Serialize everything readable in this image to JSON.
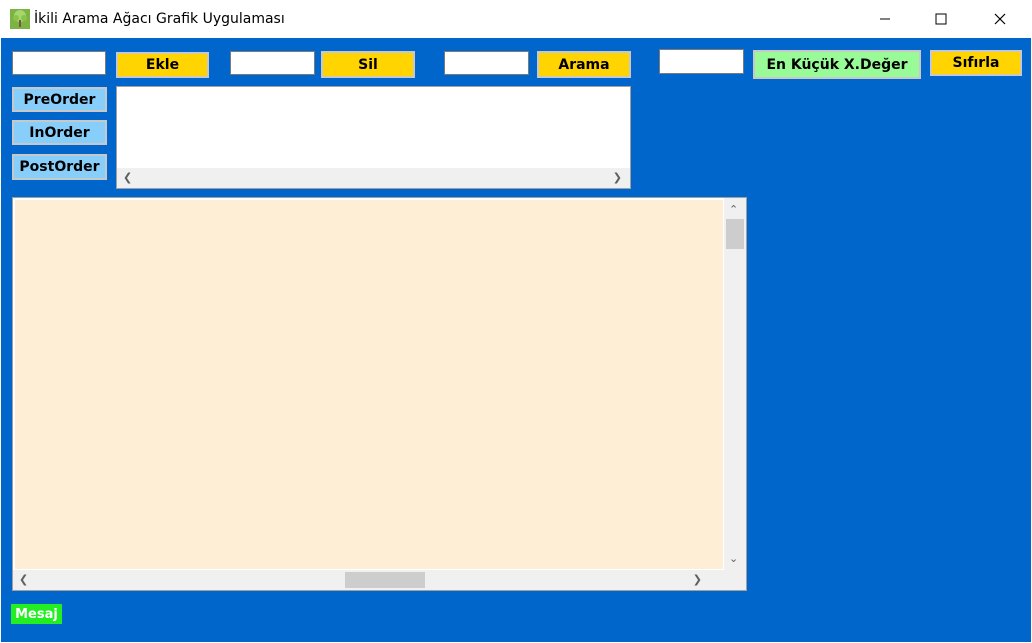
{
  "window": {
    "title": "İkili Arama Ağacı Grafik Uygulaması",
    "icon": "tree-icon",
    "controls": [
      "minimize-icon",
      "maximize-icon",
      "close-icon"
    ]
  },
  "toolbar": {
    "insert_label": "Ekle",
    "delete_label": "Sil",
    "search_label": "Arama",
    "min_label": "En Küçük X.Değer",
    "reset_label": "Sıfırla",
    "insert_input_value": "",
    "delete_input_value": "",
    "search_input_value": "",
    "min_input_value": ""
  },
  "traversal": {
    "preorder_label": "PreOrder",
    "inorder_label": "InOrder",
    "postorder_label": "PostOrder"
  },
  "output_list": {
    "items": []
  },
  "status": {
    "message_label": "Mesaj"
  },
  "colors": {
    "background": "#0066cc",
    "button_yellow": "#ffd400",
    "button_green": "#98fb98",
    "button_blue": "#87cefa",
    "canvas": "#ffeed6",
    "message_badge": "#22ee22"
  }
}
